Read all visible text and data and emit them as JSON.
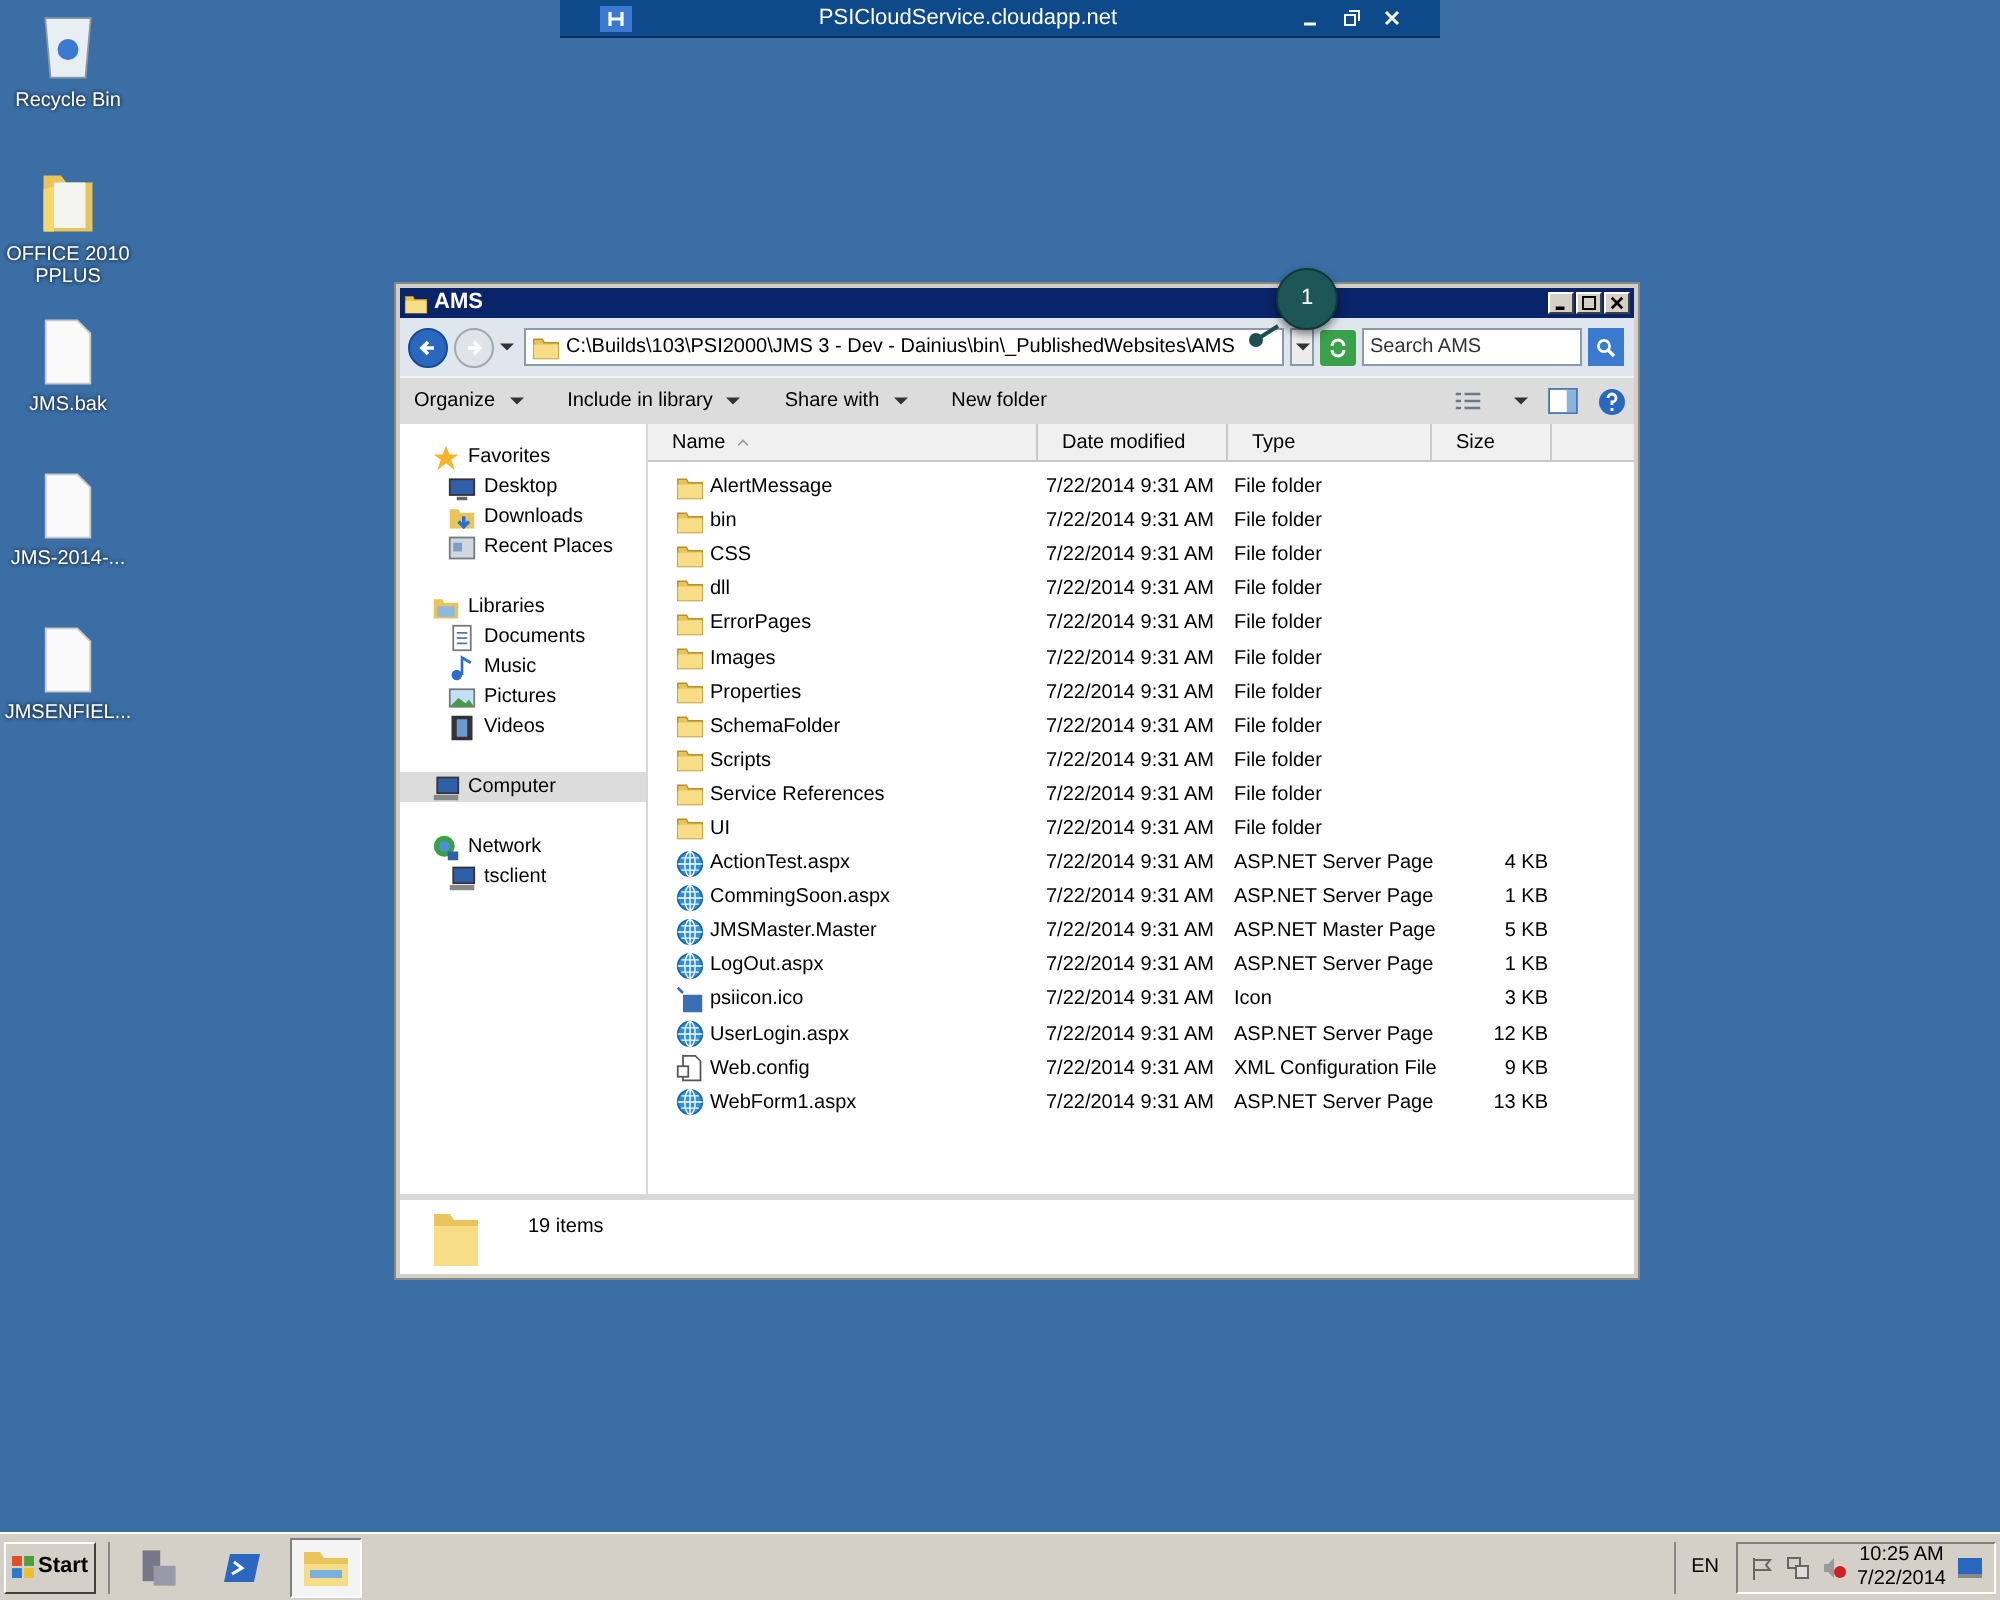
{
  "remote_bar": {
    "title": "PSICloudService.cloudapp.net"
  },
  "desktop_icons": [
    {
      "label": "Recycle Bin",
      "kind": "recycle"
    },
    {
      "label": "OFFICE 2010 PPLUS",
      "kind": "folder"
    },
    {
      "label": "JMS.bak",
      "kind": "file"
    },
    {
      "label": "JMS-2014-...",
      "kind": "file"
    },
    {
      "label": "JMSENFIEL...",
      "kind": "file"
    }
  ],
  "window": {
    "title": "AMS",
    "address": "C:\\Builds\\103\\PSI2000\\JMS 3 - Dev - Dainius\\bin\\_PublishedWebsites\\AMS",
    "search": {
      "placeholder": "Search AMS"
    },
    "toolbar": [
      {
        "label": "Organize",
        "menu": true
      },
      {
        "label": "Include in library",
        "menu": true
      },
      {
        "label": "Share with",
        "menu": true
      },
      {
        "label": "New folder",
        "menu": false
      }
    ],
    "sidebar": [
      {
        "label": "Favorites",
        "kind": "star",
        "selected": false,
        "children": [
          {
            "label": "Desktop",
            "kind": "desktop",
            "selected": false
          },
          {
            "label": "Downloads",
            "kind": "downloads",
            "selected": false
          },
          {
            "label": "Recent Places",
            "kind": "recent",
            "selected": false
          }
        ]
      },
      {
        "label": "Libraries",
        "kind": "libraries",
        "selected": false,
        "children": [
          {
            "label": "Documents",
            "kind": "documents",
            "selected": false
          },
          {
            "label": "Music",
            "kind": "music",
            "selected": false
          },
          {
            "label": "Pictures",
            "kind": "pictures",
            "selected": false
          },
          {
            "label": "Videos",
            "kind": "videos",
            "selected": false
          }
        ]
      },
      {
        "label": "Computer",
        "kind": "computer",
        "selected": true
      },
      {
        "label": "Network",
        "kind": "network",
        "selected": false,
        "children": [
          {
            "label": "tsclient",
            "kind": "computer",
            "selected": false
          }
        ]
      }
    ],
    "columns": [
      "Name",
      "Date modified",
      "Type",
      "Size"
    ],
    "rows": [
      {
        "name": "AlertMessage",
        "date": "7/22/2014 9:31 AM",
        "type": "File folder",
        "kind": "folder"
      },
      {
        "name": "bin",
        "date": "7/22/2014 9:31 AM",
        "type": "File folder",
        "kind": "folder"
      },
      {
        "name": "CSS",
        "date": "7/22/2014 9:31 AM",
        "type": "File folder",
        "kind": "folder"
      },
      {
        "name": "dll",
        "date": "7/22/2014 9:31 AM",
        "type": "File folder",
        "kind": "folder"
      },
      {
        "name": "ErrorPages",
        "date": "7/22/2014 9:31 AM",
        "type": "File folder",
        "kind": "folder"
      },
      {
        "name": "Images",
        "date": "7/22/2014 9:31 AM",
        "type": "File folder",
        "kind": "folder"
      },
      {
        "name": "Properties",
        "date": "7/22/2014 9:31 AM",
        "type": "File folder",
        "kind": "folder"
      },
      {
        "name": "SchemaFolder",
        "date": "7/22/2014 9:31 AM",
        "type": "File folder",
        "kind": "folder"
      },
      {
        "name": "Scripts",
        "date": "7/22/2014 9:31 AM",
        "type": "File folder",
        "kind": "folder"
      },
      {
        "name": "Service References",
        "date": "7/22/2014 9:31 AM",
        "type": "File folder",
        "kind": "folder"
      },
      {
        "name": "UI",
        "date": "7/22/2014 9:31 AM",
        "type": "File folder",
        "kind": "folder"
      },
      {
        "name": "ActionTest.aspx",
        "date": "7/22/2014 9:31 AM",
        "type": "ASP.NET Server Page",
        "size": "4 KB",
        "kind": "web"
      },
      {
        "name": "CommingSoon.aspx",
        "date": "7/22/2014 9:31 AM",
        "type": "ASP.NET Server Page",
        "size": "1 KB",
        "kind": "web"
      },
      {
        "name": "JMSMaster.Master",
        "date": "7/22/2014 9:31 AM",
        "type": "ASP.NET Master Page",
        "size": "5 KB",
        "kind": "web"
      },
      {
        "name": "LogOut.aspx",
        "date": "7/22/2014 9:31 AM",
        "type": "ASP.NET Server Page",
        "size": "1 KB",
        "kind": "web"
      },
      {
        "name": "psiicon.ico",
        "date": "7/22/2014 9:31 AM",
        "type": "Icon",
        "size": "3 KB",
        "kind": "ico"
      },
      {
        "name": "UserLogin.aspx",
        "date": "7/22/2014 9:31 AM",
        "type": "ASP.NET Server Page",
        "size": "12 KB",
        "kind": "web"
      },
      {
        "name": "Web.config",
        "date": "7/22/2014 9:31 AM",
        "type": "XML Configuration File",
        "size": "9 KB",
        "kind": "config"
      },
      {
        "name": "WebForm1.aspx",
        "date": "7/22/2014 9:31 AM",
        "type": "ASP.NET Server Page",
        "size": "13 KB",
        "kind": "web"
      }
    ],
    "status": "19 items"
  },
  "callout": {
    "label": "1"
  },
  "taskbar": {
    "start": "Start",
    "apps": [
      {
        "kind": "server",
        "selected": false
      },
      {
        "kind": "shell",
        "selected": false
      },
      {
        "kind": "explorer",
        "selected": true
      }
    ],
    "language": "EN",
    "time": "10:25 AM",
    "date": "7/22/2014"
  }
}
